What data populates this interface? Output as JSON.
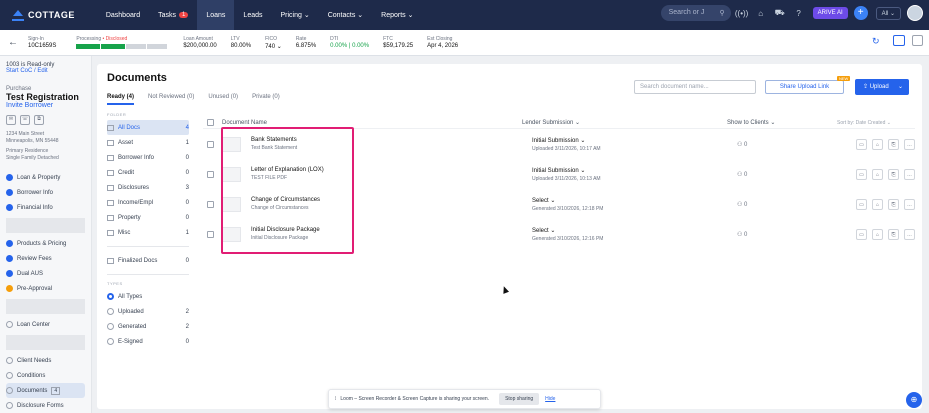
{
  "nav": {
    "logo": "COTTAGE",
    "items": [
      {
        "label": "Dashboard"
      },
      {
        "label": "Tasks",
        "badge": "1"
      },
      {
        "label": "Loans"
      },
      {
        "label": "Leads"
      },
      {
        "label": "Pricing ⌄"
      },
      {
        "label": "Contacts ⌄"
      },
      {
        "label": "Reports ⌄"
      }
    ],
    "search_placeholder": "Search or J",
    "arive": "ARIVE AI",
    "all": "All ⌄"
  },
  "loanbar": {
    "loan_tag": "Sign-In",
    "loan_id": "10C1659S",
    "processing": "Processing",
    "disclosed": "• Disclosed",
    "fields": [
      {
        "label": "Loan Amount",
        "value": "$200,000.00"
      },
      {
        "label": "LTV",
        "value": "80.00%"
      },
      {
        "label": "FICO",
        "value": "740 ⌄"
      },
      {
        "label": "Rate",
        "value": "6.875%"
      },
      {
        "label": "DTI",
        "value": "0.00% | 0.00%"
      },
      {
        "label": "FTC",
        "value": "$59,179.25"
      },
      {
        "label": "Est Closing",
        "value": "Apr 4, 2026"
      }
    ]
  },
  "sidebar": {
    "readonly": "1003 is Read-only",
    "start": "Start CoC / Edit",
    "purpose": "Purchase",
    "borrower": "Test Registration",
    "invite": "Invite Borrower",
    "addr1": "1234 Main Street",
    "addr2": "Minneapolis, MN 55448",
    "addr3": "Primary Residence",
    "addr4": "Single Family Detached",
    "items": [
      {
        "label": "Loan & Property",
        "status": "ok"
      },
      {
        "label": "Borrower Info",
        "status": "ok"
      },
      {
        "label": "Financial Info",
        "status": "ok"
      },
      {
        "label": "Products & Pricing",
        "status": "ok"
      },
      {
        "label": "Review Fees",
        "status": "ok"
      },
      {
        "label": "Dual AUS",
        "status": "ok"
      },
      {
        "label": "Pre-Approval",
        "status": "warn"
      },
      {
        "label": "Loan Center",
        "status": "none"
      },
      {
        "label": "Client Needs",
        "status": "none"
      },
      {
        "label": "Conditions",
        "status": "none"
      },
      {
        "label": "Documents",
        "status": "sel",
        "count": "4"
      },
      {
        "label": "Disclosure Forms",
        "status": "none"
      }
    ]
  },
  "main": {
    "title": "Documents",
    "tabs": [
      "Ready (4)",
      "Not Reviewed (0)",
      "Unused (0)",
      "Private (0)"
    ],
    "search_placeholder": "Search document name...",
    "share": "Share Upload Link",
    "new_badge": "NEW",
    "upload": "Upload",
    "folder_head": "FOLDER",
    "folders": [
      {
        "name": "All Docs",
        "count": "4"
      },
      {
        "name": "Asset",
        "count": "1"
      },
      {
        "name": "Borrower Info",
        "count": "0"
      },
      {
        "name": "Credit",
        "count": "0"
      },
      {
        "name": "Disclosures",
        "count": "3"
      },
      {
        "name": "Income/Empl",
        "count": "0"
      },
      {
        "name": "Property",
        "count": "0"
      },
      {
        "name": "Misc",
        "count": "1"
      }
    ],
    "finalized": {
      "name": "Finalized Docs",
      "count": "0"
    },
    "types_head": "TYPES",
    "types": [
      {
        "name": "All Types",
        "count": ""
      },
      {
        "name": "Uploaded",
        "count": "2"
      },
      {
        "name": "Generated",
        "count": "2"
      },
      {
        "name": "E-Signed",
        "count": "0"
      }
    ],
    "col_doc": "Document Name",
    "col_lender": "Lender Submission ⌄",
    "col_show": "Show to Clients ⌄",
    "col_sort": "Sort by: Date Created ⌄",
    "docs": [
      {
        "name": "Bank Statements",
        "sub": "Test Bank Statement",
        "lender": "Initial Submission ⌄",
        "lsub": "Uploaded 3/11/2026, 10:17 AM",
        "clients": "0"
      },
      {
        "name": "Letter of Explanation (LOX)",
        "sub": "TEST FILE PDF",
        "lender": "Initial Submission ⌄",
        "lsub": "Uploaded 3/11/2026, 10:13 AM",
        "clients": "0"
      },
      {
        "name": "Change of Circumstances",
        "sub": "Change of Circumstances",
        "lender": "Select ⌄",
        "lsub": "Generated 3/10/2026, 12:18 PM",
        "clients": "0"
      },
      {
        "name": "Initial Disclosure Package",
        "sub": "Initial Disclosure Package",
        "lender": "Select ⌄",
        "lsub": "Generated 3/10/2026, 12:16 PM",
        "clients": "0"
      }
    ]
  },
  "loom": {
    "text": "Loom – Screen Recorder & Screen Capture is sharing your screen.",
    "stop": "Stop sharing",
    "hide": "Hide"
  }
}
